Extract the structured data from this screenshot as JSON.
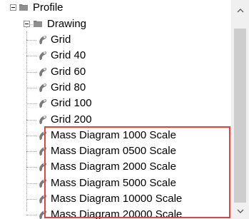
{
  "tree": {
    "root": {
      "label": "Profile",
      "icon": "folder-icon",
      "expanded": true
    },
    "folder": {
      "label": "Drawing",
      "icon": "folder-icon",
      "expanded": true
    },
    "items": [
      {
        "label": "Grid"
      },
      {
        "label": "Grid 40"
      },
      {
        "label": "Grid 60"
      },
      {
        "label": "Grid 80"
      },
      {
        "label": "Grid 100"
      },
      {
        "label": "Grid 200"
      },
      {
        "label": "Mass Diagram 1000 Scale"
      },
      {
        "label": "Mass Diagram 0500 Scale"
      },
      {
        "label": "Mass Diagram 2000 Scale"
      },
      {
        "label": "Mass Diagram 5000 Scale"
      },
      {
        "label": "Mass Diagram 10000 Scale"
      },
      {
        "label": "Mass Diagram 20000 Scale"
      }
    ]
  },
  "highlight": {
    "color": "#e8413c",
    "covers": "Mass Diagram items"
  },
  "scrollbar": {
    "up_icon": "chevron-up-icon",
    "down_icon": "chevron-down-icon"
  }
}
